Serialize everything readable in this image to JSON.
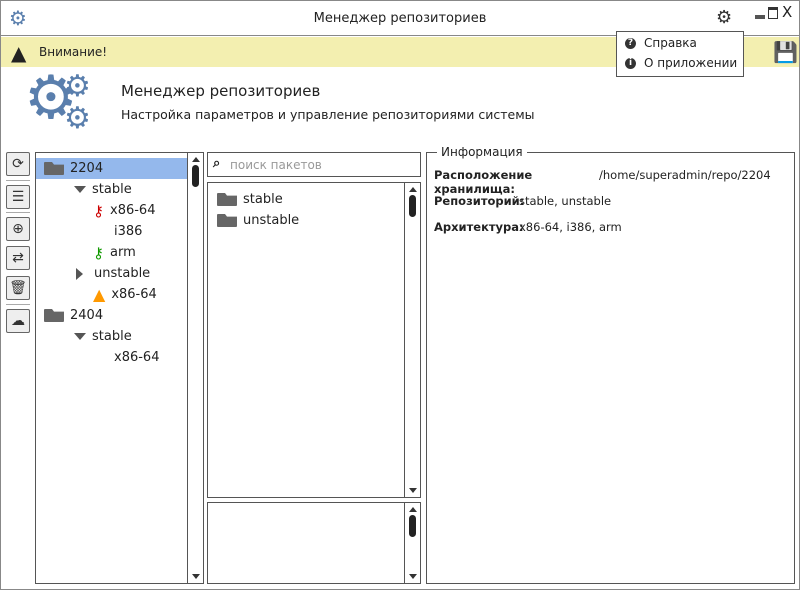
{
  "window": {
    "title": "Менеджер репозиториев"
  },
  "warning": {
    "text": "Внимание!"
  },
  "menu": {
    "items": [
      {
        "label": "Справка",
        "icon": "help-icon"
      },
      {
        "label": "О приложении",
        "icon": "info-icon"
      }
    ]
  },
  "header": {
    "title": "Менеджер репозиториев",
    "subtitle": "Настройка параметров и управление репозиториями системы"
  },
  "toolbar": [
    "refresh-icon",
    "database-icon",
    "add-icon",
    "transfer-icon",
    "trash-icon",
    "cloud-upload-icon"
  ],
  "tree": [
    {
      "label": "2204",
      "type": "folder",
      "selected": true
    },
    {
      "label": "stable",
      "type": "expanded"
    },
    {
      "label": "x86-64",
      "type": "key-red"
    },
    {
      "label": "i386",
      "type": "plain"
    },
    {
      "label": "arm",
      "type": "key-green"
    },
    {
      "label": "unstable",
      "type": "collapsed"
    },
    {
      "label": "x86-64",
      "type": "warning"
    },
    {
      "label": "2404",
      "type": "folder"
    },
    {
      "label": "stable",
      "type": "expanded"
    },
    {
      "label": "x86-64",
      "type": "plain"
    }
  ],
  "search": {
    "placeholder": "поиск пакетов"
  },
  "packages": [
    "stable",
    "unstable"
  ],
  "info": {
    "legend": "Информация",
    "rows": [
      {
        "label": "Расположение хранилища:",
        "value": "/home/superadmin/repo/2204"
      },
      {
        "label": "Репозиторий:",
        "value": "stable, unstable"
      },
      {
        "label": "Архитектура:",
        "value": "x86-64, i386, arm"
      }
    ]
  },
  "colors": {
    "warning_bar": "#f3efb0",
    "selection": "#94b8ec",
    "gear": "#5a7fad"
  }
}
